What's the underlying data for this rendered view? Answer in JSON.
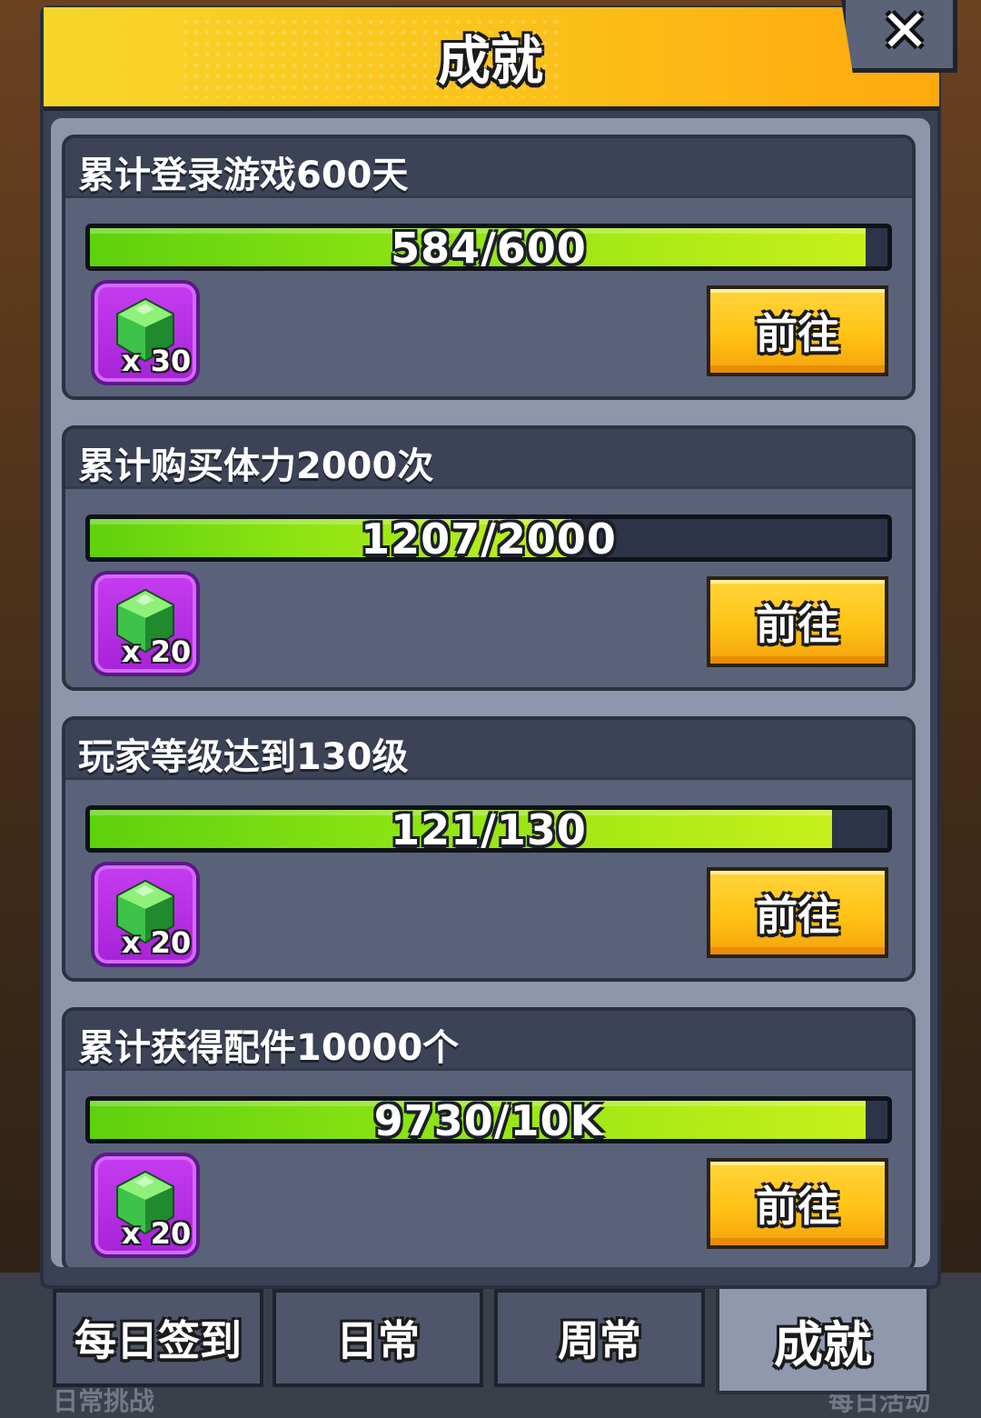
{
  "header": {
    "title": "成就"
  },
  "close": {
    "icon": "close-icon",
    "glyph": "✕"
  },
  "achievements": [
    {
      "title": "累计登录游戏600天",
      "progress_text": "584/600",
      "progress": 0.973,
      "reward_icon": "green-gem-icon",
      "reward_count": "x 30",
      "button_label": "前往"
    },
    {
      "title": "累计购买体力2000次",
      "progress_text": "1207/2000",
      "progress": 0.6035,
      "reward_icon": "green-gem-icon",
      "reward_count": "x 20",
      "button_label": "前往"
    },
    {
      "title": "玩家等级达到130级",
      "progress_text": "121/130",
      "progress": 0.931,
      "reward_icon": "green-gem-icon",
      "reward_count": "x 20",
      "button_label": "前往"
    },
    {
      "title": "累计获得配件10000个",
      "progress_text": "9730/10K",
      "progress": 0.973,
      "reward_icon": "green-gem-icon",
      "reward_count": "x 20",
      "button_label": "前往"
    }
  ],
  "tabs": [
    {
      "label": "每日签到",
      "active": false
    },
    {
      "label": "日常",
      "active": false
    },
    {
      "label": "周常",
      "active": false
    },
    {
      "label": "成就",
      "active": true
    }
  ],
  "background_labels": {
    "left": "日常挑战",
    "right": "每日活动"
  },
  "colors": {
    "header_yellow": "#fbc11a",
    "progress_green": "#8ae312",
    "button_yellow": "#ffc315",
    "reward_purple": "#b02ee0",
    "card_bg": "#5a6279"
  }
}
